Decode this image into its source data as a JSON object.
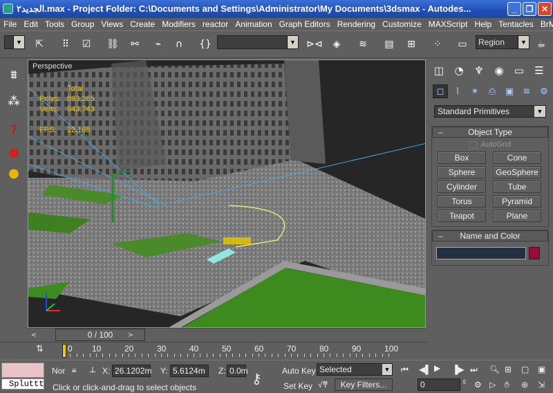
{
  "window": {
    "title": "الجديد۲.max   - Project Folder: C:\\Documents and Settings\\Administrator\\My Documents\\3dsmax   - Autodes..."
  },
  "menu": [
    "File",
    "Edit",
    "Tools",
    "Group",
    "Views",
    "Create",
    "Modifiers",
    "reactor",
    "Animation",
    "Graph Editors",
    "Rendering",
    "Customize",
    "MAXScript",
    "Help",
    "Tentacles",
    "BrMax"
  ],
  "toolbar": {
    "selection_filter": "",
    "named_selection": "",
    "region_label": "Region"
  },
  "viewport": {
    "label": "Perspective",
    "stats": {
      "total_label": "Total",
      "polys_label": "Polys:",
      "polys": "893,265",
      "verts_label": "Verts:",
      "verts": "943,743",
      "fps_label": "FPS:",
      "fps": "22.168"
    }
  },
  "command_panel": {
    "category": "Standard Primitives",
    "object_type_header": "Object Type",
    "autogrid_label": "AutoGrid",
    "primitives": [
      "Box",
      "Cone",
      "Sphere",
      "GeoSphere",
      "Cylinder",
      "Tube",
      "Torus",
      "Pyramid",
      "Teapot",
      "Plane"
    ],
    "name_color_header": "Name and Color",
    "object_color": "#9c0a3a"
  },
  "timeline": {
    "frame_display": "0 / 100",
    "ticks": [
      "0",
      "10",
      "20",
      "30",
      "40",
      "50",
      "60",
      "70",
      "80",
      "90",
      "100"
    ]
  },
  "status": {
    "script_label": "Spluttt",
    "selection_count": "Nor",
    "x_label": "X:",
    "x": "26.1202m",
    "y_label": "Y:",
    "y": "5.6124m",
    "z_label": "Z:",
    "z": "0.0m",
    "prompt": "Click or click-and-drag to select objects",
    "auto_key": "Auto Key",
    "set_key": "Set Key",
    "key_mode": "Selected",
    "key_filters": "Key Filters...",
    "current_frame": "0"
  }
}
